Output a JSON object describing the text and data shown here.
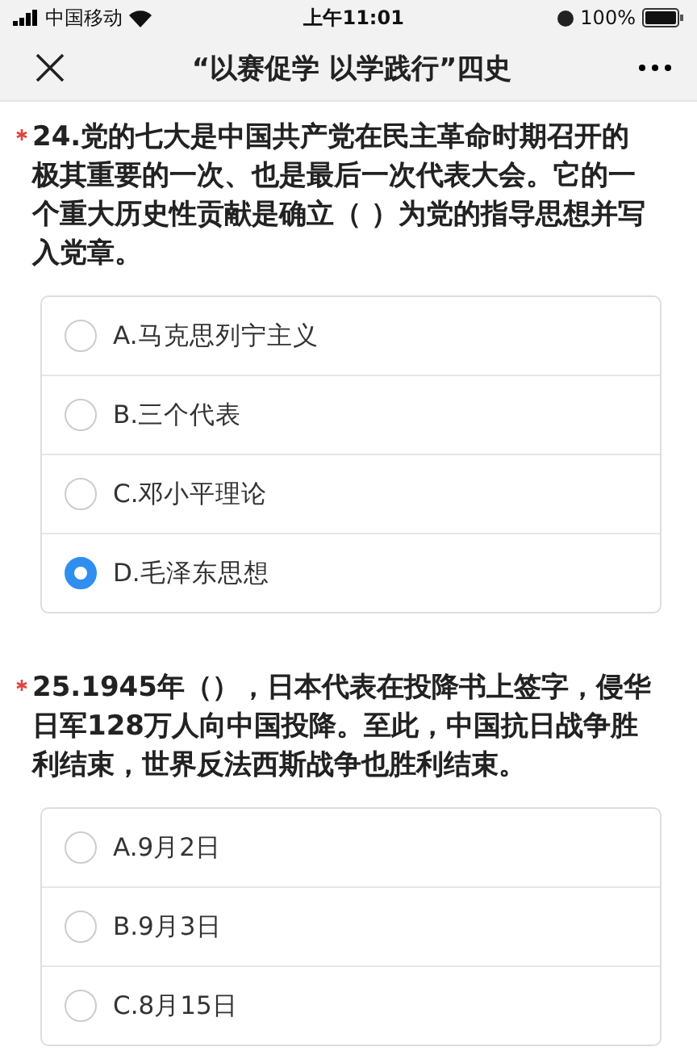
{
  "status_bar": {
    "carrier": "中国移动",
    "time": "上午11:01",
    "battery_text": "100%"
  },
  "nav": {
    "title": "“以赛促学 以学践行”四史"
  },
  "questions": [
    {
      "required": true,
      "text": "24.党的七大是中国共产党在民主革命时期召开的极其重要的一次、也是最后一次代表大会。它的一个重大历史性贡献是确立（ ）为党的指导思想并写入党章。",
      "options": [
        {
          "label": "A.马克思列宁主义",
          "selected": false
        },
        {
          "label": "B.三个代表",
          "selected": false
        },
        {
          "label": "C.邓小平理论",
          "selected": false
        },
        {
          "label": "D.毛泽东思想",
          "selected": true
        }
      ]
    },
    {
      "required": true,
      "text": "25.1945年（），日本代表在投降书上签字，侵华日军128万人向中国投降。至此，中国抗日战争胜利结束，世界反法西斯战争也胜利结束。",
      "options": [
        {
          "label": "A.9月2日",
          "selected": false
        },
        {
          "label": "B.9月3日",
          "selected": false
        },
        {
          "label": "C.8月15日",
          "selected": false
        }
      ]
    }
  ]
}
